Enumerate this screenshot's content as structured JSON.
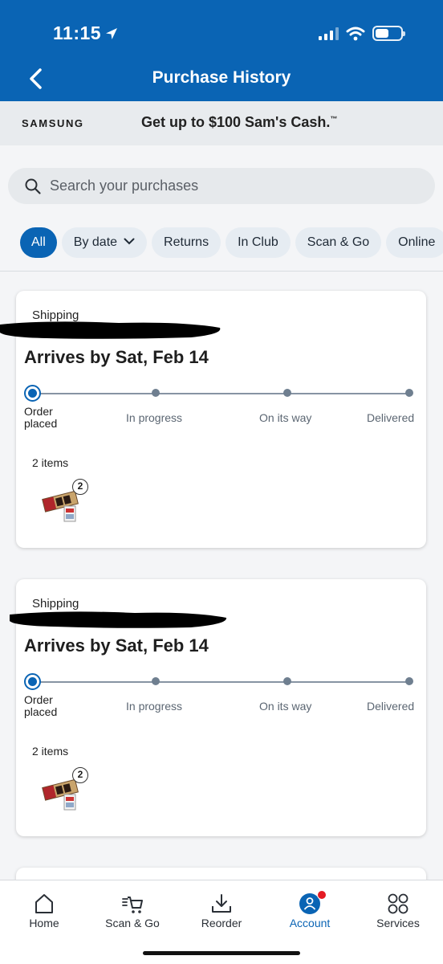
{
  "status_bar": {
    "time": "11:15"
  },
  "header": {
    "title": "Purchase History",
    "back_icon": "chevron-left-icon"
  },
  "promo": {
    "brand": "SAMSUNG",
    "text": "Get up to $100 Sam's Cash.",
    "trademark": "™"
  },
  "search": {
    "placeholder": "Search your purchases"
  },
  "filters": [
    {
      "label": "All",
      "active": true
    },
    {
      "label": "By date",
      "active": false,
      "dropdown": true
    },
    {
      "label": "Returns",
      "active": false
    },
    {
      "label": "In Club",
      "active": false
    },
    {
      "label": "Scan & Go",
      "active": false
    },
    {
      "label": "Online",
      "active": false
    }
  ],
  "orders": [
    {
      "fulfillment": "Shipping",
      "arrival": "Arrives by Sat, Feb 14",
      "steps": [
        "Order placed",
        "In progress",
        "On its way",
        "Delivered"
      ],
      "current_step": 0,
      "items_count": "2 items",
      "item_qty": "2"
    },
    {
      "fulfillment": "Shipping",
      "arrival": "Arrives by Sat, Feb 14",
      "steps": [
        "Order placed",
        "In progress",
        "On its way",
        "Delivered"
      ],
      "current_step": 0,
      "items_count": "2 items",
      "item_qty": "2"
    }
  ],
  "bottom_nav": [
    {
      "label": "Home",
      "icon": "home-icon"
    },
    {
      "label": "Scan & Go",
      "icon": "scan-cart-icon"
    },
    {
      "label": "Reorder",
      "icon": "reorder-icon"
    },
    {
      "label": "Account",
      "icon": "account-icon",
      "active": true,
      "notification": true
    },
    {
      "label": "Services",
      "icon": "services-icon"
    }
  ],
  "colors": {
    "brand_blue": "#0a64b4",
    "notification_red": "#e41b23"
  }
}
